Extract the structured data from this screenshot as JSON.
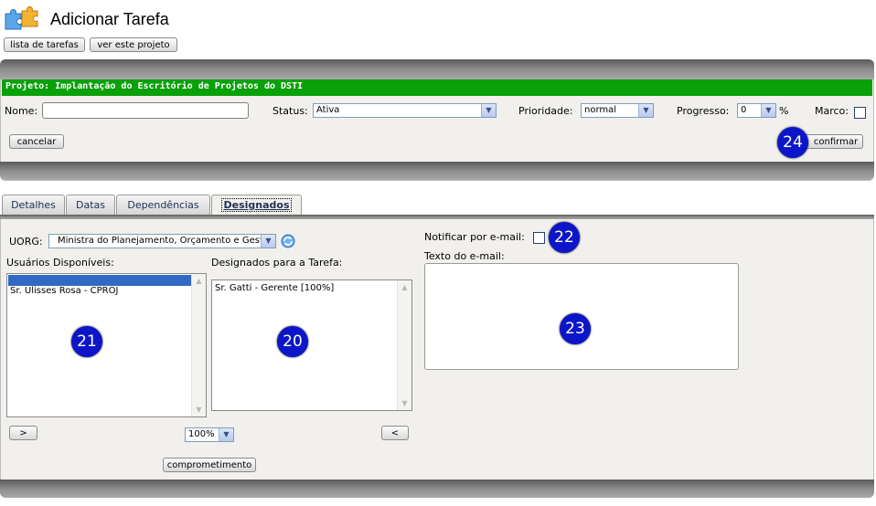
{
  "header": {
    "title": "Adicionar Tarefa",
    "buttons": {
      "list_tasks": "lista de tarefas",
      "view_project": "ver este projeto"
    }
  },
  "project_bar": {
    "label": "Projeto: Implantação do Escritório de Projetos do DSTI",
    "color": "#0aa00a"
  },
  "form": {
    "name_label": "Nome:",
    "name_value": "",
    "status_label": "Status:",
    "status_value": "Ativa",
    "priority_label": "Prioridade:",
    "priority_value": "normal",
    "progress_label": "Progresso:",
    "progress_value": "0",
    "progress_unit": "%",
    "milestone_label": "Marco:",
    "milestone_checked": false,
    "cancel_label": "cancelar",
    "confirm_label": "confirmar"
  },
  "tabs": [
    {
      "label": "Detalhes",
      "active": false
    },
    {
      "label": "Datas",
      "active": false
    },
    {
      "label": "Dependências",
      "active": false
    },
    {
      "label": "Designados",
      "active": true
    }
  ],
  "assign": {
    "uorg_label": "UORG:",
    "uorg_value": "Ministra do Planejamento, Orçamento e Gestão",
    "available_label": "Usuários Disponíveis:",
    "available_users": [
      "",
      "Sr. Ulisses Rosa - CPROJ"
    ],
    "assigned_label": "Designados para a Tarefa:",
    "assigned_users": [
      "Sr. Gatti - Gerente [100%]"
    ],
    "add_button": ">",
    "remove_button": "<",
    "percent_value": "100%",
    "commitment_button": "comprometimento",
    "notify_label": "Notificar por e-mail:",
    "email_text_label": "Texto do e-mail:",
    "email_text_value": ""
  },
  "badges": {
    "b20": "20",
    "b21": "21",
    "b22": "22",
    "b23": "23",
    "b24": "24",
    "color": "#0c16c8"
  }
}
